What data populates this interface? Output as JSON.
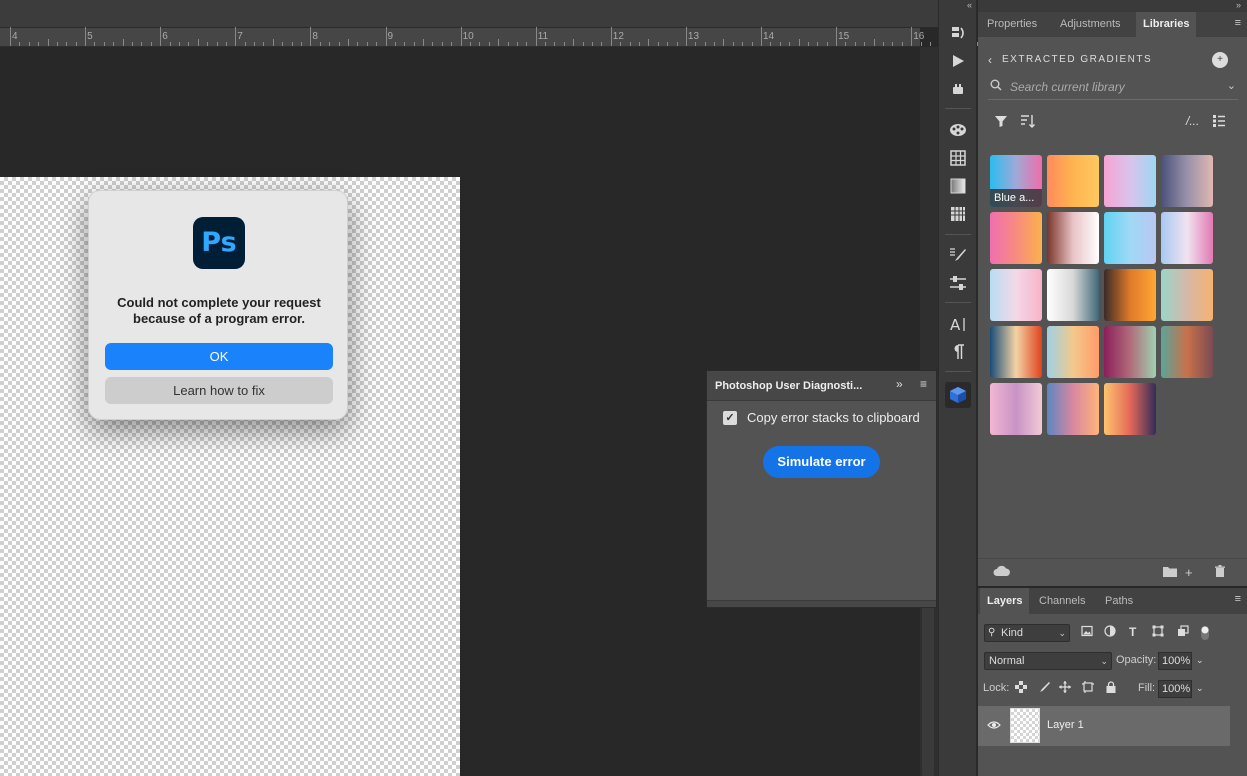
{
  "ruler": {
    "ticks": [
      "4",
      "5",
      "6",
      "7",
      "8",
      "9",
      "10",
      "11",
      "12",
      "13",
      "14",
      "15",
      "16"
    ]
  },
  "dialog": {
    "app_icon_text": "Ps",
    "message": "Could not complete your request because of a program error.",
    "ok_label": "OK",
    "learn_label": "Learn how to fix"
  },
  "diagnostics": {
    "title": "Photoshop User Diagnosti...",
    "collapse_glyph": "»",
    "checkbox_checked": true,
    "checkbox_label": "Copy error stacks to clipboard",
    "simulate_label": "Simulate error"
  },
  "panels": {
    "collapse_glyph": "«",
    "right_collapse_glyph": "»",
    "tabs": [
      "Properties",
      "Adjustments",
      "Libraries"
    ],
    "active_tab": "Libraries"
  },
  "library": {
    "name": "EXTRACTED GRADIENTS",
    "search_placeholder": "Search current library",
    "first_item_label": "Blue a...",
    "gradients": [
      {
        "colors": [
          "#2bbcf0",
          "#9fa9d6",
          "#f06eaa"
        ]
      },
      {
        "colors": [
          "#ff8a5c",
          "#ffb450",
          "#ffc860"
        ]
      },
      {
        "colors": [
          "#f6a4d3",
          "#d9c3ec",
          "#9fd6f3"
        ]
      },
      {
        "colors": [
          "#4b5079",
          "#9891aa",
          "#e0b7b1"
        ]
      },
      {
        "colors": [
          "#f06faf",
          "#f78b80",
          "#fcb04d"
        ]
      },
      {
        "colors": [
          "#7a3528",
          "#e9c3c7",
          "#ffffff"
        ]
      },
      {
        "colors": [
          "#5fd3f3",
          "#9fd9f5",
          "#b9c7f3"
        ]
      },
      {
        "colors": [
          "#a7c8f0",
          "#f1e3f1",
          "#e17ab3"
        ]
      },
      {
        "colors": [
          "#b9dcf3",
          "#f3d9e7",
          "#f8b3c8"
        ]
      },
      {
        "colors": [
          "#ffffff",
          "#d8d8d8",
          "#3f6878"
        ]
      },
      {
        "colors": [
          "#3b2a28",
          "#e07a2a",
          "#ffa733"
        ]
      },
      {
        "colors": [
          "#9ad6c9",
          "#d6b8a7",
          "#f6b270"
        ]
      },
      {
        "colors": [
          "#1a4c77",
          "#f3d3a5",
          "#e0421f"
        ]
      },
      {
        "colors": [
          "#9ed1e5",
          "#f3c98c",
          "#ff9b6a"
        ]
      },
      {
        "colors": [
          "#8b1f5a",
          "#b06b7a",
          "#9fd1b0"
        ]
      },
      {
        "colors": [
          "#5ba59a",
          "#c9714a",
          "#7b4b54"
        ]
      },
      {
        "colors": [
          "#f3b7d3",
          "#c893c5",
          "#f2c9d6"
        ]
      },
      {
        "colors": [
          "#5c86c3",
          "#d9879f",
          "#ffb47a"
        ]
      },
      {
        "colors": [
          "#ffc46c",
          "#e5685a",
          "#322c59"
        ]
      }
    ]
  },
  "layers": {
    "tabs": [
      "Layers",
      "Channels",
      "Paths"
    ],
    "active_tab": "Layers",
    "filter_kind": "Kind",
    "blend_mode": "Normal",
    "opacity_label": "Opacity:",
    "opacity_value": "100%",
    "lock_label": "Lock:",
    "fill_label": "Fill:",
    "fill_value": "100%",
    "layer_name": "Layer 1"
  },
  "colors": {
    "ok_button": "#1a82fb",
    "simulate_button": "#1473e6",
    "ps_icon_bg": "#001e36",
    "ps_icon_fg": "#31a8ff"
  }
}
